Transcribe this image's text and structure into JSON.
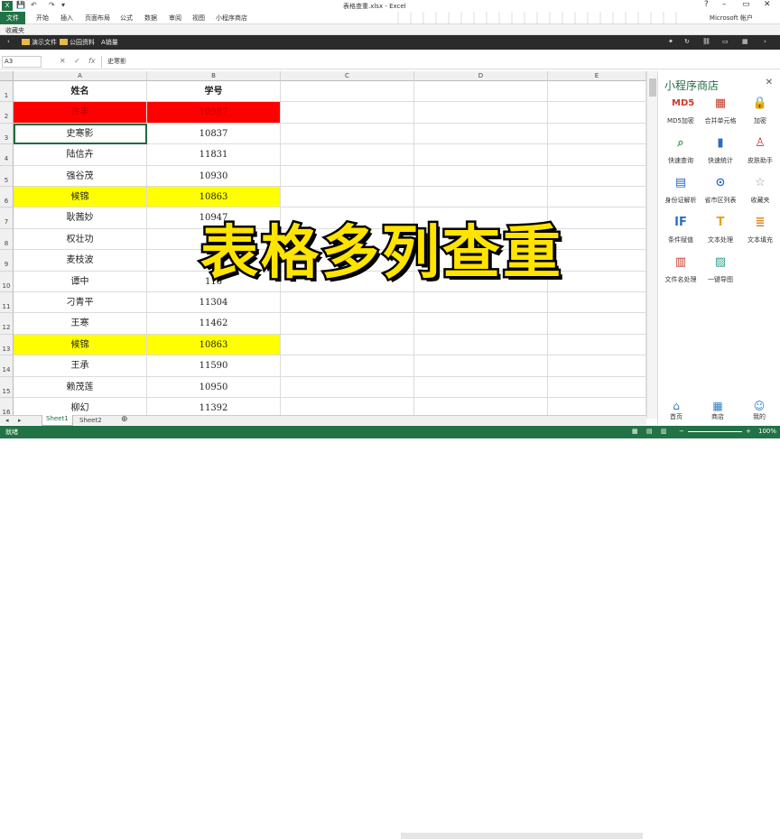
{
  "window": {
    "title": "表格查重.xlsx - Excel",
    "account": "Microsoft 帐户"
  },
  "ribbon_tabs": [
    "文件",
    "开始",
    "插入",
    "页面布局",
    "公式",
    "数据",
    "审阅",
    "视图",
    "小程序商店"
  ],
  "favorites": {
    "label": "收藏夹",
    "items": [
      "演示文件",
      "公园资料",
      "A销量"
    ]
  },
  "formula_bar": {
    "name_box": "A3",
    "fx": "fx",
    "value": "史寒影"
  },
  "columns": [
    "A",
    "B",
    "C",
    "D",
    "E"
  ],
  "rows": [
    {
      "num": "1",
      "name": "姓名",
      "id": "学号",
      "style": "hdr"
    },
    {
      "num": "2",
      "name": "许丰",
      "id": "10987",
      "style": "red"
    },
    {
      "num": "3",
      "name": "史寒影",
      "id": "10837",
      "style": "sel"
    },
    {
      "num": "4",
      "name": "陆信卉",
      "id": "11831",
      "style": ""
    },
    {
      "num": "5",
      "name": "强谷茂",
      "id": "10930",
      "style": ""
    },
    {
      "num": "6",
      "name": "候锦",
      "id": "10863",
      "style": "yellow"
    },
    {
      "num": "7",
      "name": "耿茜妙",
      "id": "10947",
      "style": ""
    },
    {
      "num": "8",
      "name": "权壮功",
      "id": "11",
      "style": ""
    },
    {
      "num": "9",
      "name": "麦枝波",
      "id": "1",
      "style": ""
    },
    {
      "num": "10",
      "name": "谭中",
      "id": "116",
      "style": ""
    },
    {
      "num": "11",
      "name": "刁青平",
      "id": "11304",
      "style": ""
    },
    {
      "num": "12",
      "name": "王寒",
      "id": "11462",
      "style": ""
    },
    {
      "num": "13",
      "name": "候锦",
      "id": "10863",
      "style": "yellow"
    },
    {
      "num": "14",
      "name": "王承",
      "id": "11590",
      "style": ""
    },
    {
      "num": "15",
      "name": "赖茂莲",
      "id": "10950",
      "style": ""
    },
    {
      "num": "16",
      "name": "柳幻",
      "id": "11392",
      "style": ""
    }
  ],
  "overlay_text": "表格多列查重",
  "panel": {
    "title": "小程序商店",
    "tools": [
      {
        "label": "MD5加密",
        "icon": "md5-icon",
        "glyph": "MD5",
        "color": "#d0392b"
      },
      {
        "label": "合并单元格",
        "icon": "merge-cells-icon",
        "glyph": "▦",
        "color": "#c0392b"
      },
      {
        "label": "加密",
        "icon": "lock-icon",
        "glyph": "🔒",
        "color": "#c0392b"
      },
      {
        "label": "快速查询",
        "icon": "search-icon",
        "glyph": "⌕",
        "color": "#2e9e4f"
      },
      {
        "label": "快速统计",
        "icon": "bar-chart-icon",
        "glyph": "▮",
        "color": "#2b6cc4"
      },
      {
        "label": "皮肤助手",
        "icon": "shirt-icon",
        "glyph": "♙",
        "color": "#c0392b"
      },
      {
        "label": "身份证解析",
        "icon": "id-card-icon",
        "glyph": "▤",
        "color": "#2b6cc4"
      },
      {
        "label": "省市区列表",
        "icon": "location-icon",
        "glyph": "⊙",
        "color": "#2b6cc4"
      },
      {
        "label": "收藏夹",
        "icon": "star-icon",
        "glyph": "☆",
        "color": "#999999"
      },
      {
        "label": "条件赋值",
        "icon": "if-icon",
        "glyph": "IF",
        "color": "#2b6cc4"
      },
      {
        "label": "文本处理",
        "icon": "text-t-icon",
        "glyph": "T",
        "color": "#e8a317"
      },
      {
        "label": "文本填充",
        "icon": "doc-fill-icon",
        "glyph": "≣",
        "color": "#d98a1c"
      },
      {
        "label": "文件名处理",
        "icon": "file-icon",
        "glyph": "▥",
        "color": "#c0392b"
      },
      {
        "label": "一键导图",
        "icon": "image-icon",
        "glyph": "▨",
        "color": "#2e9e8e"
      }
    ],
    "nav": [
      {
        "label": "首页",
        "icon": "home-icon",
        "glyph": "⌂"
      },
      {
        "label": "商店",
        "icon": "store-icon",
        "glyph": "▦"
      },
      {
        "label": "我的",
        "icon": "user-icon",
        "glyph": "☺"
      }
    ]
  },
  "sheets": [
    "Sheet1",
    "Sheet2"
  ],
  "status": {
    "left": "就绪",
    "zoom": "100%"
  }
}
